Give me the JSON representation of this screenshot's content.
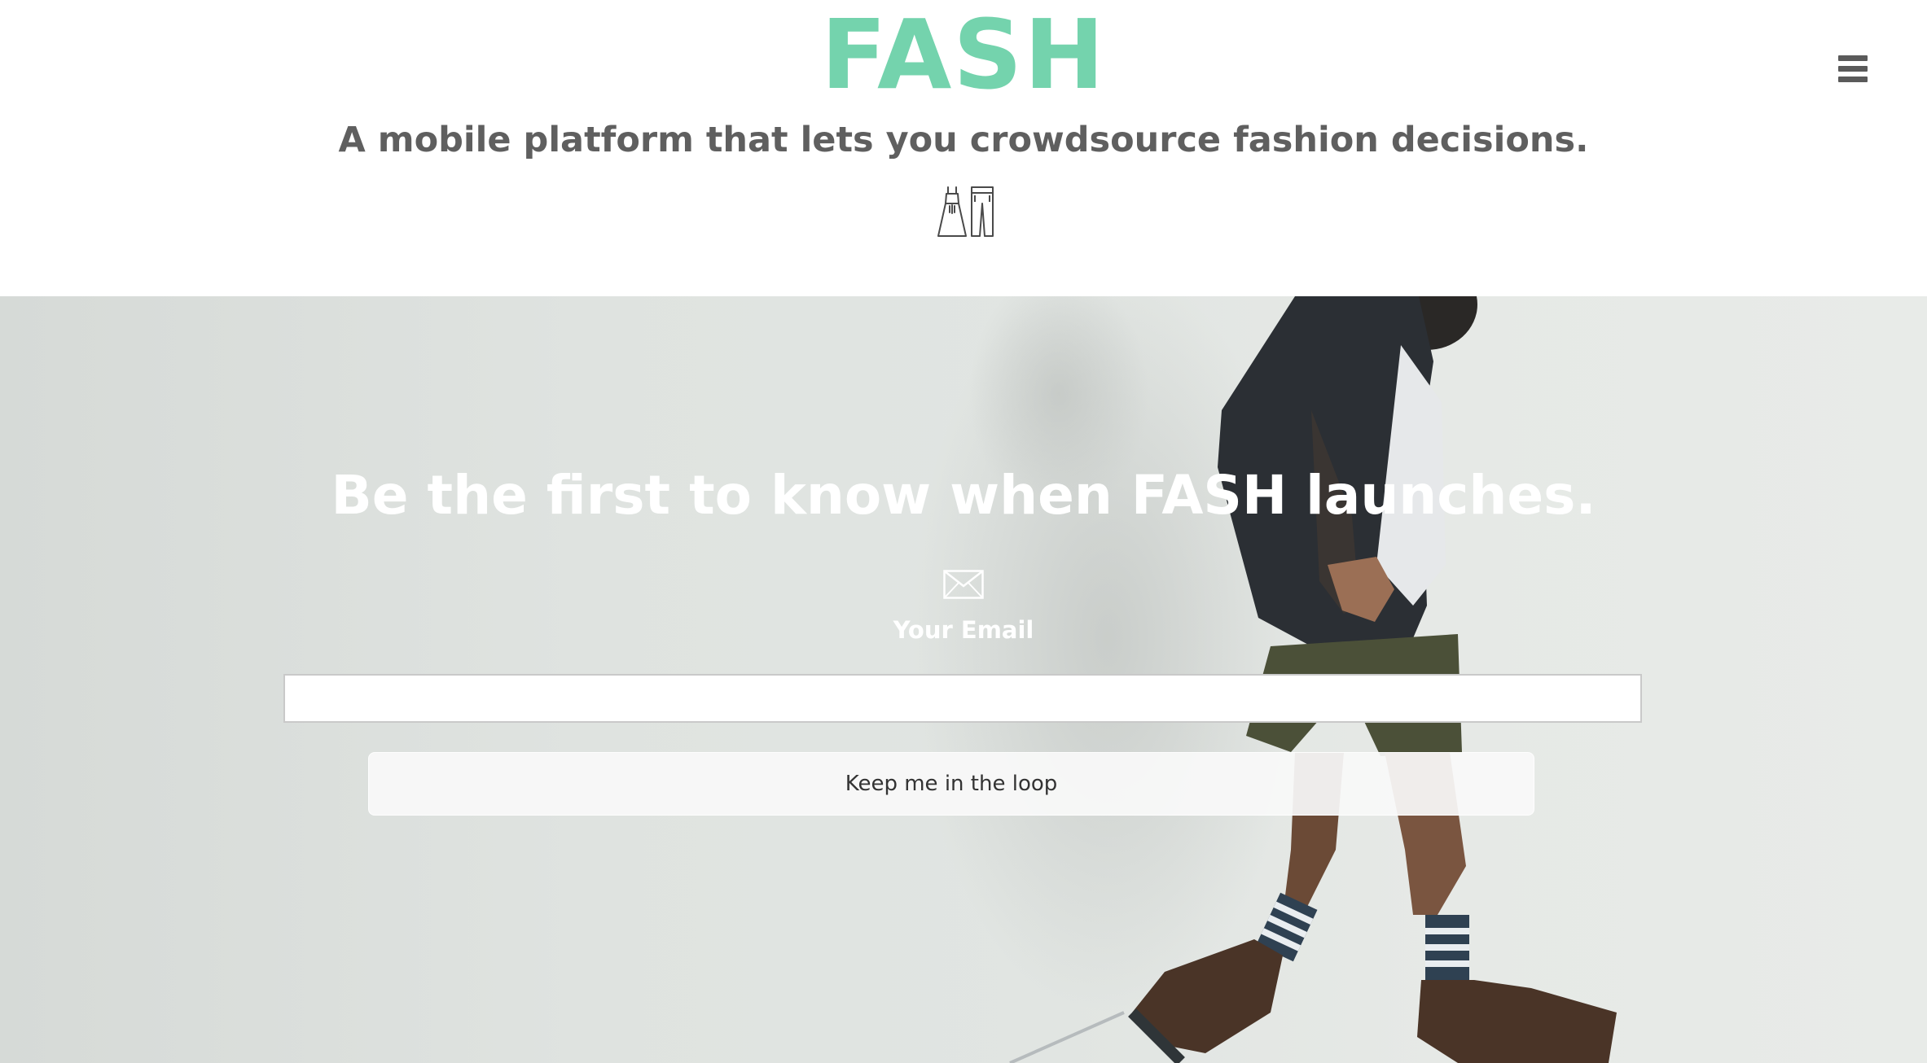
{
  "header": {
    "logo_text": "FASH",
    "tagline": "A mobile platform that lets you crowdsource fashion decisions.",
    "garments_icon": "dress-and-pants-icon",
    "menu_icon": "hamburger-menu-icon"
  },
  "hero": {
    "title": "Be the first to know when FASH launches.",
    "mail_icon": "envelope-icon",
    "email_label": "Your Email",
    "email_value": "",
    "email_placeholder": "",
    "submit_label": "Keep me in the loop"
  },
  "colors": {
    "brand": "#74d3ad",
    "tagline": "#5f5f5f",
    "hero_background": "#dfe3e0",
    "hero_text": "#ffffff"
  }
}
